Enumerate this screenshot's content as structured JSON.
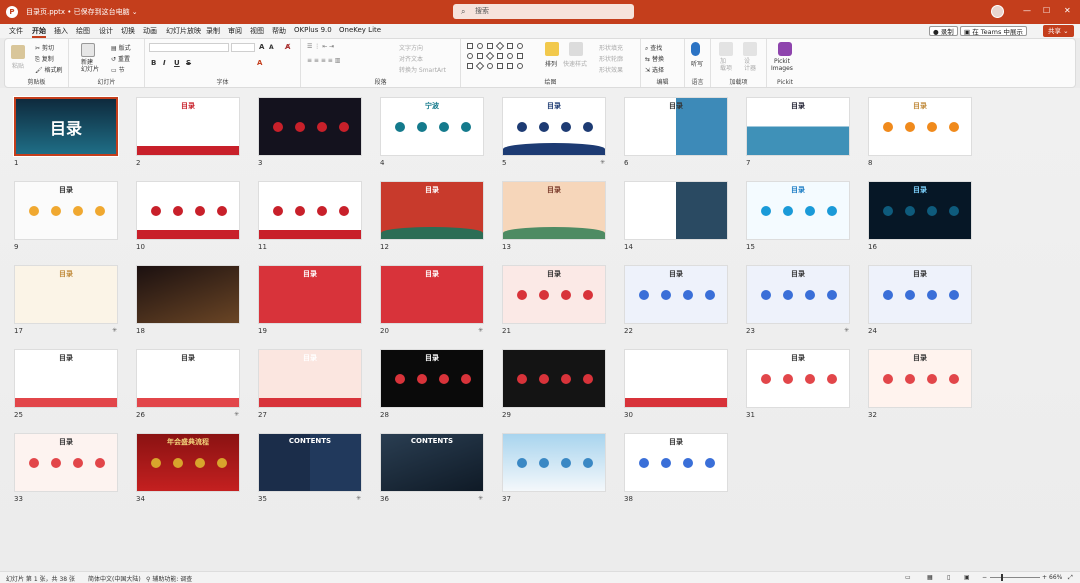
{
  "titlebar": {
    "logo": "P",
    "filename": "目录页.pptx • 已保存到这台电脑 ⌄",
    "search_placeholder": "搜索",
    "colors": {
      "accent": "#c43e1c"
    }
  },
  "menu": {
    "items": [
      "文件",
      "开始",
      "插入",
      "绘图",
      "设计",
      "切换",
      "动画",
      "幻灯片放映",
      "录制",
      "审阅",
      "视图",
      "帮助",
      "OKPlus 9.0",
      "OneKey Lite"
    ],
    "active_index": 1,
    "record_label": "录制",
    "teams_label": "在 Teams 中展示",
    "share_label": "共享"
  },
  "ribbon": {
    "clipboard": {
      "paste": "粘贴",
      "cut": "剪切",
      "copy": "复制",
      "format_painter": "格式刷",
      "label": "剪贴板"
    },
    "slides": {
      "new_slide": "新建\n幻灯片",
      "layout": "版式",
      "reset": "重置",
      "section": "节",
      "label": "幻灯片"
    },
    "font": {
      "label": "字体",
      "bold": "B",
      "italic": "I",
      "underline": "U",
      "strike": "S",
      "grow": "A",
      "shrink": "A"
    },
    "paragraph": {
      "label": "段落",
      "text_direction": "文字方向",
      "align_text": "对齐文本",
      "smartart": "转换为 SmartArt"
    },
    "drawing": {
      "label": "绘图",
      "arrange": "排列",
      "quick_styles": "快速样式",
      "shape_fill": "形状填充",
      "shape_outline": "形状轮廓",
      "shape_effects": "形状效果"
    },
    "editing": {
      "label": "编辑",
      "find": "查找",
      "replace": "替换",
      "select": "选择"
    },
    "voice": {
      "label": "语言",
      "dictate": "听写"
    },
    "addins": {
      "label": "加载项",
      "addins": "加\n载项",
      "designer": "设\n计器"
    },
    "pickit": {
      "label": "Pickit",
      "name": "Pickit\nImages"
    }
  },
  "slides": [
    {
      "num": "1",
      "title": "目录",
      "star": false
    },
    {
      "num": "2",
      "title": "目录",
      "star": false
    },
    {
      "num": "3",
      "title": "",
      "star": false
    },
    {
      "num": "4",
      "title": "宁波",
      "star": false
    },
    {
      "num": "5",
      "title": "目录",
      "star": true
    },
    {
      "num": "6",
      "title": "目录",
      "star": false
    },
    {
      "num": "7",
      "title": "目录",
      "star": false
    },
    {
      "num": "8",
      "title": "目录",
      "star": false
    },
    {
      "num": "9",
      "title": "目录",
      "star": false
    },
    {
      "num": "10",
      "title": "",
      "star": false
    },
    {
      "num": "11",
      "title": "",
      "star": false
    },
    {
      "num": "12",
      "title": "目录",
      "star": false
    },
    {
      "num": "13",
      "title": "目录",
      "star": false
    },
    {
      "num": "14",
      "title": "",
      "star": false
    },
    {
      "num": "15",
      "title": "目录",
      "star": false
    },
    {
      "num": "16",
      "title": "目录",
      "star": false
    },
    {
      "num": "17",
      "title": "目录",
      "star": true
    },
    {
      "num": "18",
      "title": "",
      "star": false
    },
    {
      "num": "19",
      "title": "目录",
      "star": false
    },
    {
      "num": "20",
      "title": "目录",
      "star": true
    },
    {
      "num": "21",
      "title": "目录",
      "star": false
    },
    {
      "num": "22",
      "title": "目录",
      "star": false
    },
    {
      "num": "23",
      "title": "目录",
      "star": true
    },
    {
      "num": "24",
      "title": "目录",
      "star": false
    },
    {
      "num": "25",
      "title": "目录",
      "star": false
    },
    {
      "num": "26",
      "title": "目录",
      "star": true
    },
    {
      "num": "27",
      "title": "目录",
      "star": false
    },
    {
      "num": "28",
      "title": "目录",
      "star": false
    },
    {
      "num": "29",
      "title": "",
      "star": false
    },
    {
      "num": "30",
      "title": "目录",
      "star": false
    },
    {
      "num": "31",
      "title": "目录",
      "star": false
    },
    {
      "num": "32",
      "title": "目录",
      "star": false
    },
    {
      "num": "33",
      "title": "目录",
      "star": false
    },
    {
      "num": "34",
      "title": "年会盛典流程",
      "star": false
    },
    {
      "num": "35",
      "title": "CONTENTS",
      "star": true
    },
    {
      "num": "36",
      "title": "CONTENTS",
      "star": true
    },
    {
      "num": "37",
      "title": "",
      "star": false
    },
    {
      "num": "38",
      "title": "目录",
      "star": false
    }
  ],
  "status": {
    "slide_info": "幻灯片 第 1 张，共 38 张",
    "language": "简体中文(中国大陆)",
    "accessibility": "辅助功能: 调查",
    "zoom": "66%"
  }
}
